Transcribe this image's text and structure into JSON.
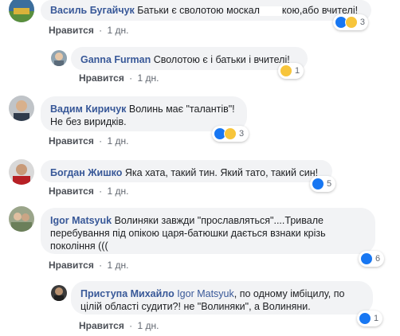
{
  "actions": {
    "like_label": "Нравится",
    "dot": "·",
    "time": "1 дн."
  },
  "comments": [
    {
      "author": "Василь Бугайчук",
      "text_part1": "Батьки є сволотою москал",
      "text_part2": "кою,або вчителі!",
      "reaction_count": "3"
    },
    {
      "author": "Ganna Furman",
      "text": "Сволотою є і батьки і вчителі!",
      "reaction_count": "1"
    },
    {
      "author": "Вадим Киричук",
      "text_line1": "Волинь має \"талантів\"!",
      "text_line2": "Не без виридків.",
      "reaction_count": "3"
    },
    {
      "author": "Богдан Жишко",
      "text": "Яка хата, такий тин. Який тато, такий син!",
      "reaction_count": "5"
    },
    {
      "author": "Igor Matsyuk",
      "text_line1": "Волиняки завжди \"прославляться\"....Тривале",
      "text_line2": "перебування під опікою царя-батюшки дається взнаки крізь",
      "text_line3": "покоління (((",
      "reaction_count": "6"
    },
    {
      "author": "Приступа Михайло",
      "mention": "Igor Matsyuk",
      "text_line1": ", по одному імбіцилу, по",
      "text_line2": "цілій області судити?! не \"Волиняки\", а Волиняни.",
      "reaction_count": "1"
    }
  ]
}
